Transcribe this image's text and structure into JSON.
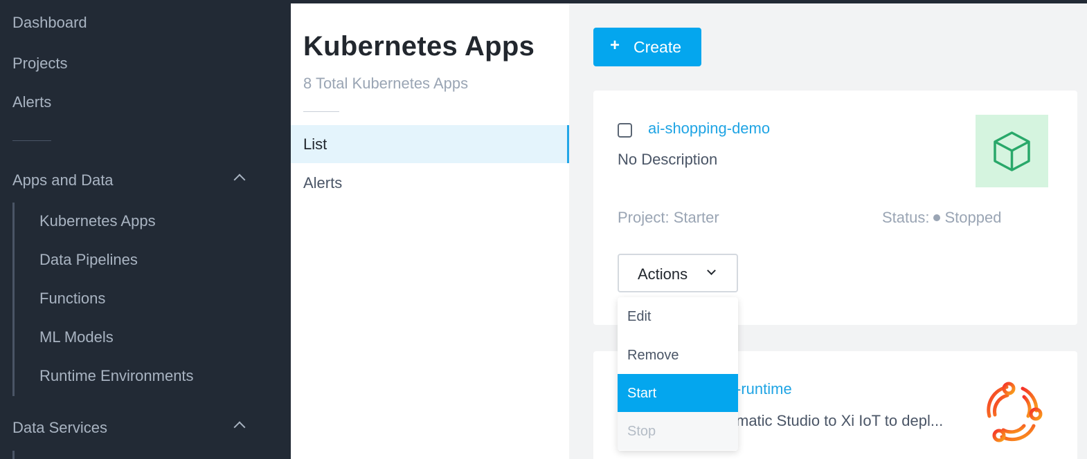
{
  "sidebar": {
    "items": [
      {
        "label": "Dashboard"
      },
      {
        "label": "Projects"
      },
      {
        "label": "Alerts"
      }
    ],
    "sections": [
      {
        "label": "Apps and Data",
        "expanded": true,
        "items": [
          {
            "label": "Kubernetes Apps"
          },
          {
            "label": "Data Pipelines"
          },
          {
            "label": "Functions"
          },
          {
            "label": "ML Models"
          },
          {
            "label": "Runtime Environments"
          }
        ]
      },
      {
        "label": "Data Services",
        "expanded": true,
        "items": []
      }
    ]
  },
  "panel": {
    "title": "Kubernetes Apps",
    "subtitle": "8 Total Kubernetes Apps",
    "tabs": [
      {
        "label": "List",
        "active": true
      },
      {
        "label": "Alerts",
        "active": false
      }
    ]
  },
  "toolbar": {
    "create_label": "Create",
    "create_icon": "plus-icon"
  },
  "apps": [
    {
      "name": "ai-shopping-demo",
      "description": "No Description",
      "project_label": "Project: Starter",
      "status_label": "Status:",
      "status_value": "Stopped",
      "icon": "cube-icon",
      "actions_label": "Actions"
    },
    {
      "name": "-runtime",
      "description": "matic Studio to Xi IoT to depl...",
      "icon": "runtime-logo-icon"
    }
  ],
  "actions_menu": {
    "items": [
      {
        "label": "Edit",
        "state": "normal"
      },
      {
        "label": "Remove",
        "state": "normal"
      },
      {
        "label": "Start",
        "state": "highlighted"
      },
      {
        "label": "Stop",
        "state": "disabled"
      }
    ]
  },
  "colors": {
    "accent": "#04a6ee",
    "sidebar_bg": "#222a35",
    "link": "#1fa4e4",
    "cube_green": "#29a86a",
    "runtime_orange": "#f0552a"
  }
}
